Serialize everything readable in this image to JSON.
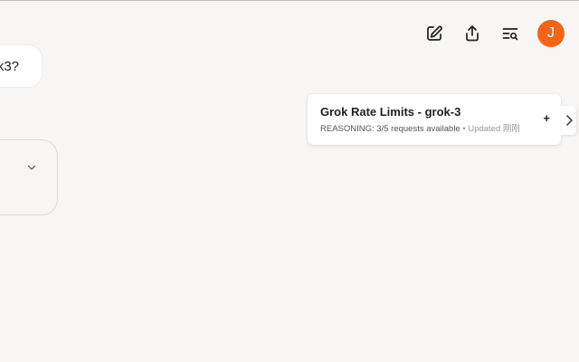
{
  "header": {
    "icons": [
      "edit-icon",
      "share-icon",
      "search-history-icon"
    ],
    "avatar_initial": "J",
    "avatar_color": "#f26418"
  },
  "conversation": {
    "user_message_visible": "k3?"
  },
  "rate_limits": {
    "title": "Grok Rate Limits - grok-3",
    "mode": "REASONING:",
    "status": "3/5 requests available",
    "separator": "•",
    "updated": "Updated 刚刚",
    "add_label": "+"
  }
}
